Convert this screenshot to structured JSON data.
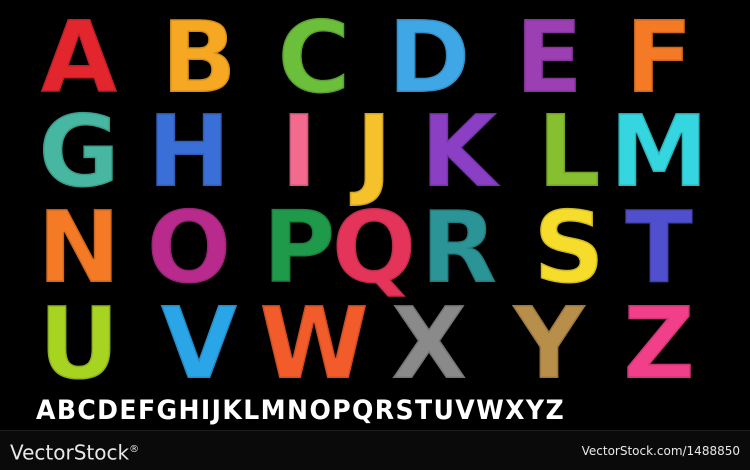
{
  "alphabet_rows": [
    [
      {
        "char": "A",
        "color": "#e3262e"
      },
      {
        "char": "B",
        "color": "#f7a823"
      },
      {
        "char": "C",
        "color": "#6bbf3b"
      },
      {
        "char": "D",
        "color": "#3fa7e6"
      },
      {
        "char": "E",
        "color": "#9c3fb3"
      },
      {
        "char": "F",
        "color": "#f47a25"
      }
    ],
    [
      {
        "char": "G",
        "color": "#47b7a1"
      },
      {
        "char": "H",
        "color": "#3a6fd8"
      },
      {
        "char": "I",
        "color": "#f36a8f"
      },
      {
        "char": "J",
        "color": "#f6c22b"
      },
      {
        "char": "K",
        "color": "#8a3fc4"
      },
      {
        "char": "L",
        "color": "#86bf2f"
      },
      {
        "char": "M",
        "color": "#35d6df"
      }
    ],
    [
      {
        "char": "N",
        "color": "#f47a25"
      },
      {
        "char": "O",
        "color": "#b82b8d"
      },
      {
        "char": "P",
        "color": "#1f9a4a"
      },
      {
        "char": "Q",
        "color": "#e5345a"
      },
      {
        "char": "R",
        "color": "#2b9496"
      },
      {
        "char": "S",
        "color": "#f7dd2b"
      },
      {
        "char": "T",
        "color": "#5050cf"
      }
    ],
    [
      {
        "char": "U",
        "color": "#a7d321"
      },
      {
        "char": "V",
        "color": "#2aa6e8"
      },
      {
        "char": "W",
        "color": "#f25b2a"
      },
      {
        "char": "X",
        "color": "#8a8a8a"
      },
      {
        "char": "Y",
        "color": "#b78e4a"
      },
      {
        "char": "Z",
        "color": "#f23f89"
      }
    ]
  ],
  "small_alphabet": "ABCDEFGHIJKLMNOPQRSTUVWXYZ",
  "watermark": {
    "logo_text": "VectorStock",
    "logo_mark": "®",
    "url_text": "VectorStock.com/1488850"
  }
}
